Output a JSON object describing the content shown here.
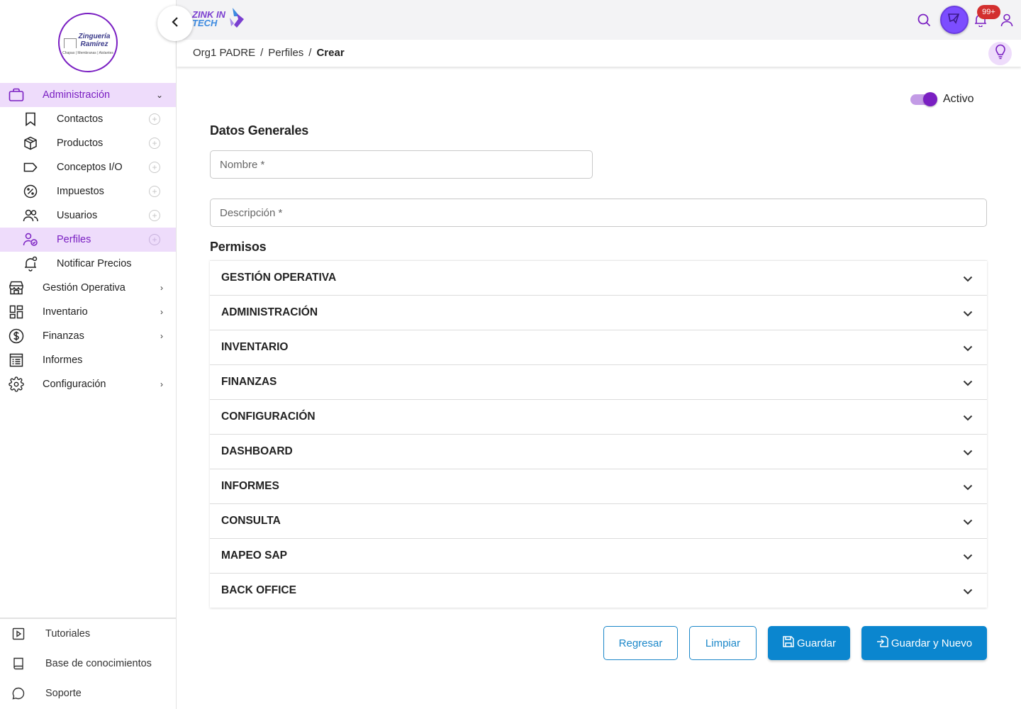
{
  "sidebar": {
    "logo": {
      "line1": "Zinguería",
      "line2": "Ramírez",
      "line3": "Chapas | Membranas | Aislantes"
    },
    "menu": [
      {
        "label": "Administración",
        "icon": "briefcase-icon",
        "active": true,
        "expanded": true
      },
      {
        "label": "Contactos",
        "icon": "bookmark-icon"
      },
      {
        "label": "Productos",
        "icon": "package-icon"
      },
      {
        "label": "Conceptos I/O",
        "icon": "tag-icon"
      },
      {
        "label": "Impuestos",
        "icon": "percent-icon"
      },
      {
        "label": "Usuarios",
        "icon": "users-icon"
      },
      {
        "label": "Perfiles",
        "icon": "user-check-icon",
        "active": true
      },
      {
        "label": "Notificar Precios",
        "icon": "bell-icon"
      },
      {
        "label": "Gestión Operativa",
        "icon": "store-icon"
      },
      {
        "label": "Inventario",
        "icon": "grid-icon"
      },
      {
        "label": "Finanzas",
        "icon": "dollar-icon"
      },
      {
        "label": "Informes",
        "icon": "report-icon"
      },
      {
        "label": "Configuración",
        "icon": "gear-icon"
      }
    ],
    "bottom": [
      {
        "label": "Tutoriales",
        "icon": "play-icon"
      },
      {
        "label": "Base de conocimientos",
        "icon": "book-icon"
      },
      {
        "label": "Soporte",
        "icon": "chat-icon"
      }
    ]
  },
  "topbar": {
    "brand_line1": "ZINK IN",
    "brand_line2": "TECH",
    "notification_count": "99+"
  },
  "breadcrumb": {
    "items": [
      "Org1 PADRE",
      "Perfiles",
      "Crear"
    ],
    "separator": "/"
  },
  "form": {
    "active_label": "Activo",
    "active": true,
    "general_title": "Datos Generales",
    "name_placeholder": "Nombre *",
    "description_placeholder": "Descripción *",
    "permissions_title": "Permisos",
    "permissions": [
      "GESTIÓN OPERATIVA",
      "ADMINISTRACIÓN",
      "INVENTARIO",
      "FINANZAS",
      "CONFIGURACIÓN",
      "DASHBOARD",
      "INFORMES",
      "CONSULTA",
      "MAPEO SAP",
      "BACK OFFICE"
    ]
  },
  "actions": {
    "back": "Regresar",
    "clear": "Limpiar",
    "save": "Guardar",
    "save_new": "Guardar y Nuevo"
  },
  "colors": {
    "accent": "#7a1fc2",
    "accent_light": "#eedcfb",
    "primary": "#0b86cf"
  }
}
